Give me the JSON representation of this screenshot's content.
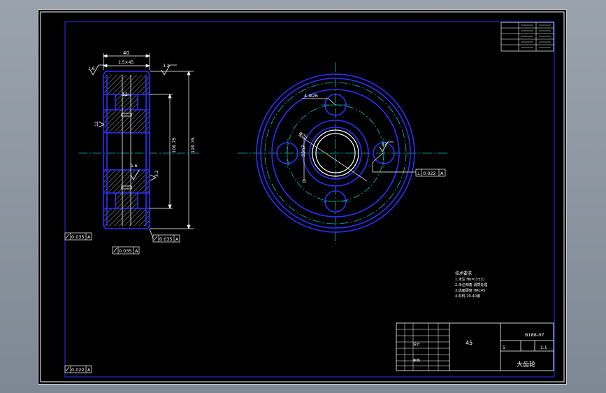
{
  "dimensions": {
    "width": "40",
    "chamfer": "1.5×45",
    "hub_width": "12",
    "root_dia": "100.75",
    "outer_dia": "120.35",
    "bore_dim": "55h7",
    "holes": "4-Φ26",
    "pcd": "Φ75"
  },
  "roughness": {
    "r1": "1.6",
    "r2": "3.2",
    "r3": "12",
    "r4": "1.6",
    "r5": "3.2",
    "r6": "12"
  },
  "tolerances": {
    "left_runout": "0.035",
    "left_datum": "A",
    "bottom_runout": "0.035",
    "bottom_datum": "A",
    "right_runout": "0.035",
    "right_datum": "A",
    "front_runout": "0.022",
    "front_datum": "A",
    "corner_runout": "0.022",
    "corner_datum": "A"
  },
  "notes": {
    "title": "技术要求",
    "line1": "1.未注 Hb=(3±2)",
    "line2": "2.未注倒角 调质处理",
    "line3": "3.齿面硬度 HRC45",
    "line4": "4.材料 20-40钢"
  },
  "title_block": {
    "drawing_no": "B188-07",
    "material": "45",
    "scale_label": "5",
    "scale": "1:1",
    "part_name": "大齿轮",
    "designer": "设计",
    "checker": "审核"
  },
  "colors": {
    "outline": "#2f2fff",
    "center": "#00c0c0",
    "hatch": "#c8c8c8",
    "text": "#ffffff",
    "dim": "#ffffff"
  }
}
